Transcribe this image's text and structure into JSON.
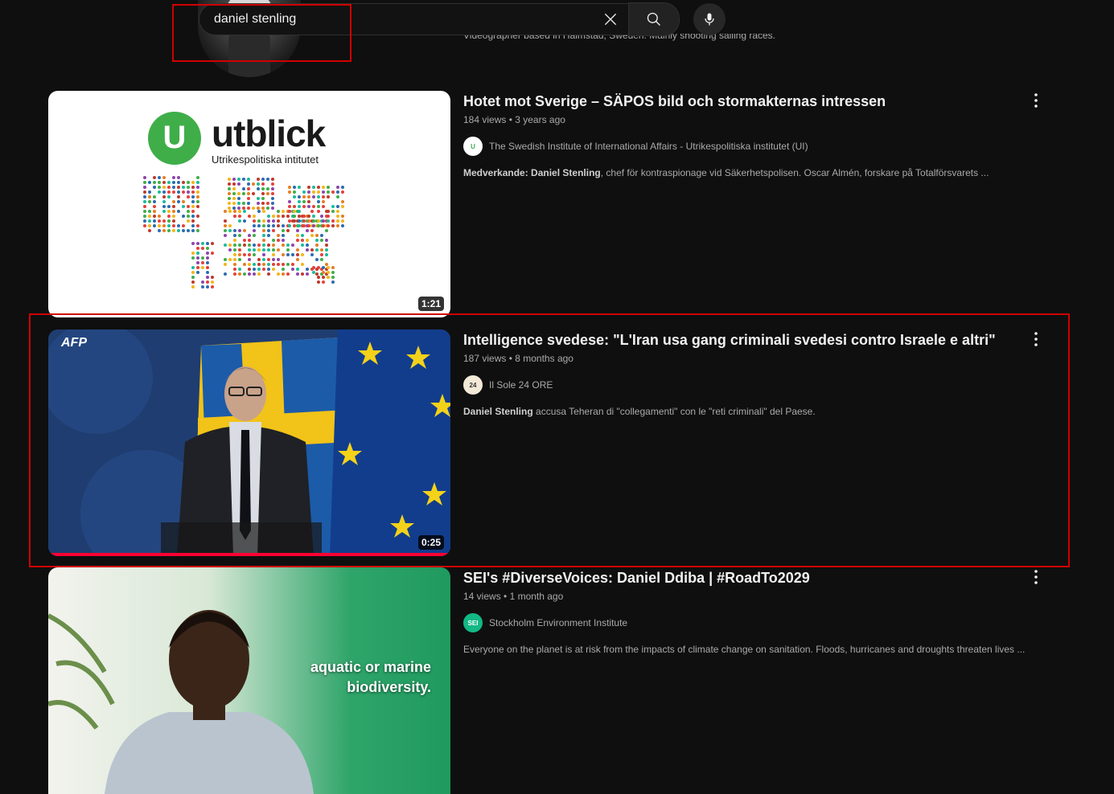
{
  "search": {
    "query": "daniel stenling",
    "placeholder": "Search"
  },
  "partial_result": {
    "description": "Videographer based in Halmstad, Sweden. Mainly shooting sailing races."
  },
  "results": [
    {
      "title": "Hotet mot Sverige – SÄPOS bild och stormakternas intressen",
      "views": "184 views",
      "age": "3 years ago",
      "channel": "The Swedish Institute of International Affairs - Utrikespolitiska institutet (UI)",
      "channel_avatar": "U",
      "desc_bold": "Medverkande:",
      "desc_bold2": "Daniel Stenling",
      "desc_rest": ", chef för kontraspionage vid Säkerhetspolisen. Oscar Almén, forskare på Totalförsvarets ...",
      "duration": "1:21",
      "thumb_logo_word": "utblick",
      "thumb_logo_sub": "Utrikespolitiska intitutet",
      "thumb_logo_letter": "U"
    },
    {
      "title": "Intelligence svedese: \"L'Iran usa gang criminali svedesi contro Israele e altri\"",
      "views": "187 views",
      "age": "8 months ago",
      "channel": "Il Sole 24 ORE",
      "channel_avatar": "24",
      "desc_bold": "Daniel Stenling",
      "desc_rest": " accusa Teheran di \"collegamenti\" con le \"reti criminali\" del Paese.",
      "duration": "0:25",
      "thumb_brand": "AFP",
      "progress": 1.0
    },
    {
      "title": "SEI's #DiverseVoices: Daniel Ddiba | #RoadTo2029",
      "views": "14 views",
      "age": "1 month ago",
      "channel": "Stockholm Environment Institute",
      "channel_avatar": "SEI",
      "desc_rest": "Everyone on the planet is at risk from the impacts of climate change on sanitation. Floods, hurricanes and droughts threaten lives ...",
      "caption_line1": "aquatic or marine",
      "caption_line2": "biodiversity."
    }
  ],
  "colors": {
    "background": "#0f0f0f",
    "accent": "#ff0033",
    "annotation": "#d00000"
  },
  "icons": [
    "close-icon",
    "search-icon",
    "microphone-icon",
    "more-vert-icon"
  ]
}
